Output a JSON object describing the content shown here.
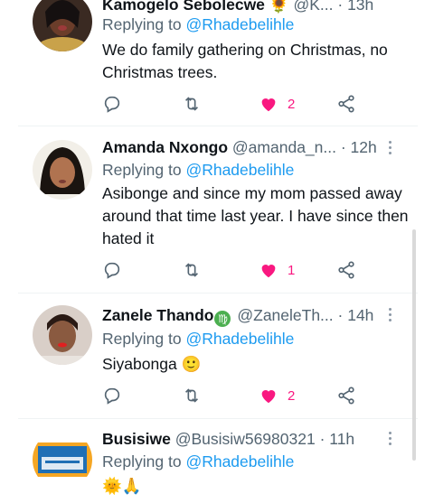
{
  "replying_prefix": "Replying to",
  "tweets": [
    {
      "name": "Kamogelo Sebolecwe",
      "name_emoji": "🌻",
      "handle": "@K...",
      "time": "· 13h",
      "reply_to": "@Rhadebelihle",
      "text": "We do family gathering on Christmas, no Christmas trees.",
      "likes": "2"
    },
    {
      "name": "Amanda Nxongo",
      "handle": "@amanda_n...",
      "time": "· 12h",
      "reply_to": "@Rhadebelihle",
      "text": "Asibonge and since my mom passed away around that time last year. I have since then hated it",
      "likes": "1"
    },
    {
      "name": "Zanele Thando",
      "name_emoji": "♍",
      "handle": "@ZaneleTh...",
      "time": "· 14h",
      "reply_to": "@Rhadebelihle",
      "text": "Siyabonga 🙂",
      "likes": "2"
    },
    {
      "name": "Busisiwe",
      "handle": "@Busisiw56980321",
      "time": "· 11h",
      "reply_to": "@Rhadebelihle",
      "text": "🌞🙏"
    }
  ],
  "colors": {
    "like": "#f91880",
    "mention": "#1d9bf0",
    "secondary": "#536471"
  },
  "icons": [
    "reply-icon",
    "retweet-icon",
    "heart-filled-icon",
    "share-icon",
    "more-icon"
  ]
}
